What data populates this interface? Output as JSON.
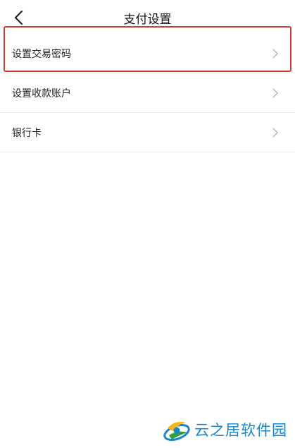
{
  "header": {
    "title": "支付设置",
    "back_icon": "chevron-left-icon"
  },
  "settings": {
    "items": [
      {
        "label": "设置交易密码",
        "icon": "chevron-right-icon"
      },
      {
        "label": "设置收款账户",
        "icon": "chevron-right-icon"
      },
      {
        "label": "银行卡",
        "icon": "chevron-right-icon"
      }
    ]
  },
  "watermark": {
    "text": "云之居软件园"
  },
  "colors": {
    "highlight": "#d23c32",
    "watermark_text": "#1a85c9",
    "divider": "#ececec",
    "chevron": "#b5b5b5"
  }
}
